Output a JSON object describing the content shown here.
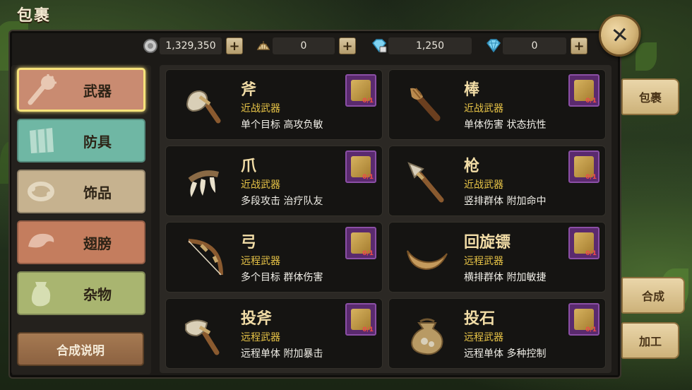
{
  "title": "包裹",
  "close": {
    "symbol": "✕"
  },
  "currencies": [
    {
      "icon": "silver-coin-icon",
      "value": "1,329,350",
      "plus": "+"
    },
    {
      "icon": "shell-icon",
      "value": "0",
      "plus": "+"
    },
    {
      "icon": "locked-diamond-icon",
      "value": "1,250"
    },
    {
      "icon": "diamond-icon",
      "value": "0",
      "plus": "+"
    }
  ],
  "categories": [
    {
      "label": "武器",
      "icon": "club-icon",
      "color": "#c98b71",
      "active": true
    },
    {
      "label": "防具",
      "icon": "armor-icon",
      "color": "#6fb7a4",
      "active": false
    },
    {
      "label": "饰品",
      "icon": "bracelet-icon",
      "color": "#c6b28f",
      "active": false
    },
    {
      "label": "翅膀",
      "icon": "wing-icon",
      "color": "#c47d5e",
      "active": false
    },
    {
      "label": "杂物",
      "icon": "jar-icon",
      "color": "#a9b570",
      "active": false
    }
  ],
  "recipe_button": "合成说明",
  "items": [
    {
      "name": "斧",
      "type": "近战武器",
      "desc": "单个目标 高攻负敏",
      "icon": "stone-axe-icon",
      "count": "0/1"
    },
    {
      "name": "棒",
      "type": "近战武器",
      "desc": "单体伤害 状态抗性",
      "icon": "club-icon",
      "count": "0/1"
    },
    {
      "name": "爪",
      "type": "近战武器",
      "desc": "多段攻击 治疗队友",
      "icon": "claw-icon",
      "count": "0/1"
    },
    {
      "name": "枪",
      "type": "近战武器",
      "desc": "竖排群体 附加命中",
      "icon": "spear-icon",
      "count": "0/1"
    },
    {
      "name": "弓",
      "type": "远程武器",
      "desc": "多个目标 群体伤害",
      "icon": "bow-icon",
      "count": "0/1"
    },
    {
      "name": "回旋镖",
      "type": "远程武器",
      "desc": "横排群体 附加敏捷",
      "icon": "boomerang-icon",
      "count": "0/1"
    },
    {
      "name": "投斧",
      "type": "远程武器",
      "desc": "远程单体 附加暴击",
      "icon": "throwing-axe-icon",
      "count": "0/1"
    },
    {
      "name": "投石",
      "type": "远程武器",
      "desc": "远程单体 多种控制",
      "icon": "stone-bag-icon",
      "count": "0/1"
    }
  ],
  "side_tabs": {
    "bag": "包裹",
    "craft": "合成",
    "process": "加工"
  },
  "colors": {
    "accent": "#e9c547",
    "active_border": "#f6e27a",
    "count_red": "#f04a4a"
  }
}
